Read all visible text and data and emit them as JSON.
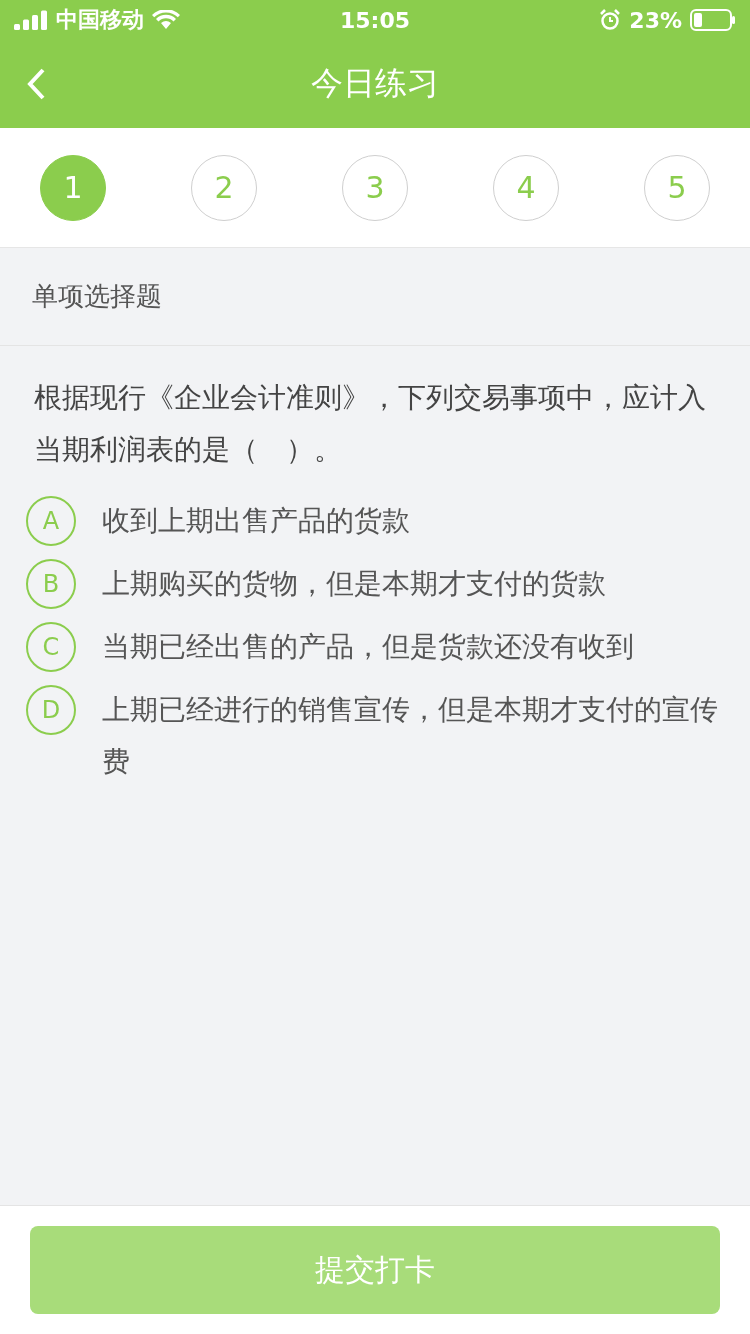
{
  "status_bar": {
    "carrier": "中国移动",
    "time": "15:05",
    "battery": "23%"
  },
  "nav": {
    "title": "今日练习"
  },
  "steps": [
    {
      "label": "1",
      "selected": true
    },
    {
      "label": "2",
      "selected": false
    },
    {
      "label": "3",
      "selected": false
    },
    {
      "label": "4",
      "selected": false
    },
    {
      "label": "5",
      "selected": false
    }
  ],
  "section_title": "单项选择题",
  "question": "根据现行《企业会计准则》，下列交易事项中，应计入当期利润表的是（　）。",
  "options": [
    {
      "letter": "A",
      "text": "收到上期出售产品的货款",
      "selected": false
    },
    {
      "letter": "B",
      "text": "上期购买的货物，但是本期才支付的货款",
      "selected": false
    },
    {
      "letter": "C",
      "text": "当期已经出售的产品，但是货款还没有收到",
      "selected": false
    },
    {
      "letter": "D",
      "text": "上期已经进行的销售宣传，但是本期才支付的宣传费",
      "selected": false
    }
  ],
  "submit": {
    "label": "提交打卡",
    "disabled": true
  }
}
